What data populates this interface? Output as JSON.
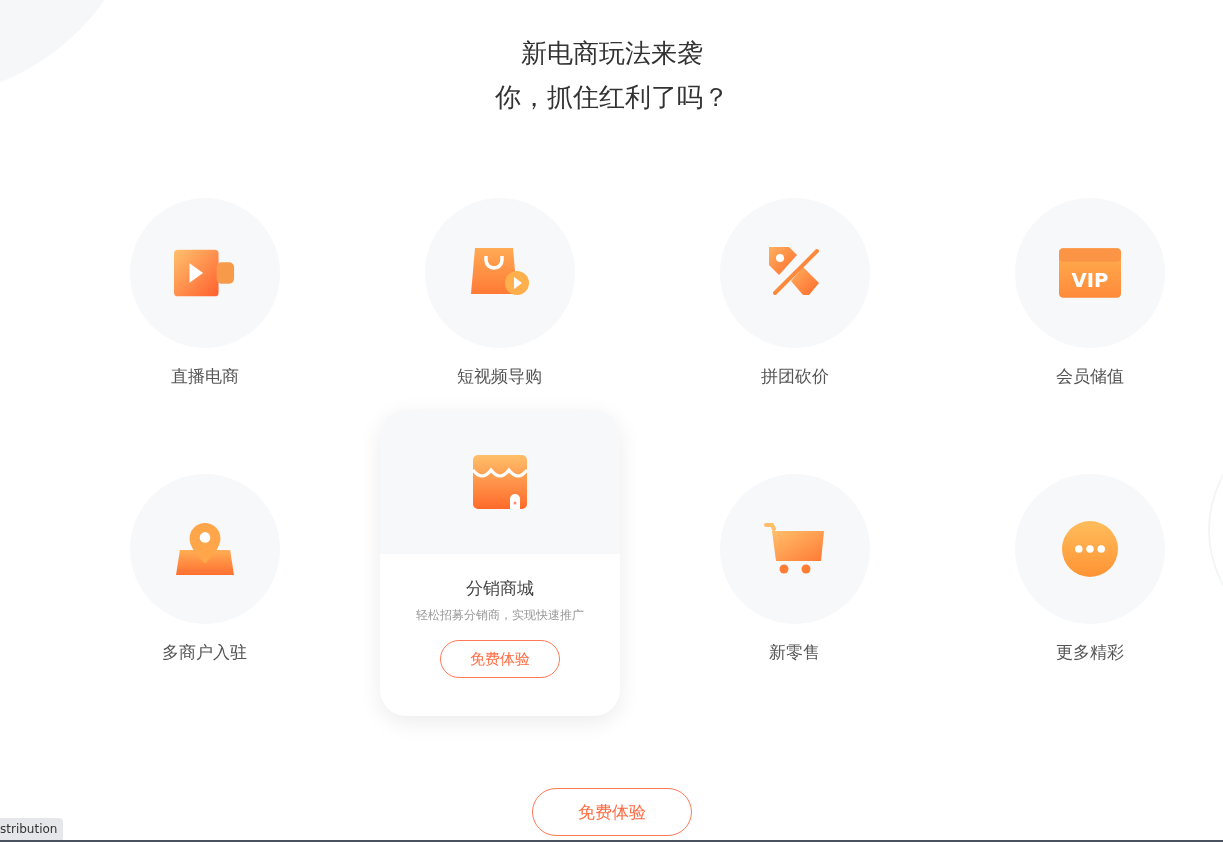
{
  "heading": {
    "line_1": "新电商玩法来袭",
    "line_2": "你，抓住红利了吗？"
  },
  "features": [
    {
      "label": "直播电商",
      "selected": false
    },
    {
      "label": "短视频导购",
      "selected": false
    },
    {
      "label": "拼团砍价",
      "selected": false
    },
    {
      "label": "会员储值",
      "selected": false,
      "icon_text": "VIP"
    },
    {
      "label": "多商户入驻",
      "selected": false
    },
    {
      "label": "分销商城",
      "selected": true,
      "description": "轻松招募分销商，实现快速推广",
      "button": "免费体验"
    },
    {
      "label": "新零售",
      "selected": false
    },
    {
      "label": "更多精彩",
      "selected": false
    }
  ],
  "cta_button": "免费体验",
  "status_text": "stribution"
}
